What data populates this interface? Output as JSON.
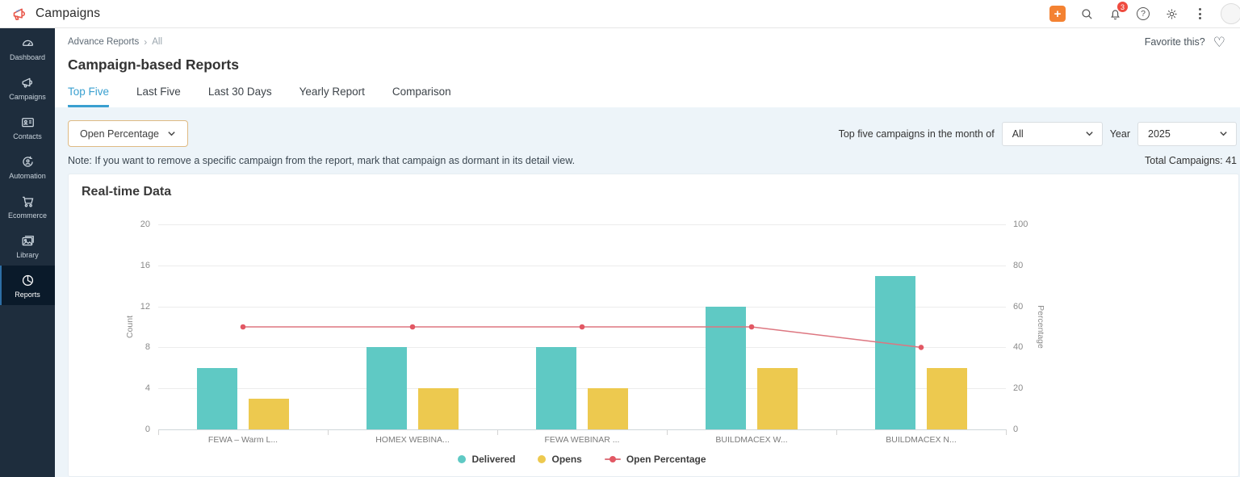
{
  "app": {
    "logo_text": "Campaigns"
  },
  "topbar": {
    "plus_label": "+",
    "notification_count": "3",
    "help_glyph": "?",
    "icons": [
      "plus-button",
      "search-icon",
      "bell-icon",
      "help-icon",
      "gear-icon",
      "kebab-icon",
      "avatar"
    ]
  },
  "sidebar": {
    "items": [
      {
        "label": "Dashboard",
        "icon": "dashboard-icon",
        "active": false
      },
      {
        "label": "Campaigns",
        "icon": "campaigns-icon",
        "active": false
      },
      {
        "label": "Contacts",
        "icon": "contacts-icon",
        "active": false
      },
      {
        "label": "Automation",
        "icon": "automation-icon",
        "active": false
      },
      {
        "label": "Ecommerce",
        "icon": "ecommerce-icon",
        "active": false
      },
      {
        "label": "Library",
        "icon": "library-icon",
        "active": false
      },
      {
        "label": "Reports",
        "icon": "reports-icon",
        "active": true
      }
    ]
  },
  "page": {
    "breadcrumb": {
      "first": "Advance Reports",
      "separator": "›",
      "last": "All"
    },
    "favorite_label": "Favorite this?",
    "favorite_icon": "♡",
    "title": "Campaign-based Reports",
    "tabs": [
      {
        "label": "Top Five",
        "active": true
      },
      {
        "label": "Last Five",
        "active": false
      },
      {
        "label": "Last 30 Days",
        "active": false
      },
      {
        "label": "Yearly Report",
        "active": false
      },
      {
        "label": "Comparison",
        "active": false
      }
    ],
    "filters": {
      "metric_dropdown": "Open Percentage",
      "month_label": "Top five campaigns in the month of",
      "month_value": "All",
      "year_label": "Year",
      "year_value": "2025"
    },
    "note": "Note: If you want to remove a specific campaign from the report, mark that campaign as dormant in its detail view.",
    "total_campaigns": "Total Campaigns: 41"
  },
  "chart_data": {
    "type": "bar",
    "title": "Real-time Data",
    "categories": [
      "FEWA – Warm L...",
      "HOMEX WEBINA...",
      "FEWA WEBINAR ...",
      "BUILDMACEX W...",
      "BUILDMACEX N..."
    ],
    "series": [
      {
        "name": "Delivered",
        "type": "bar",
        "axis": "left",
        "color": "#5fc9c4",
        "values": [
          6,
          8,
          8,
          12,
          15
        ]
      },
      {
        "name": "Opens",
        "type": "bar",
        "axis": "left",
        "color": "#edc94f",
        "values": [
          3,
          4,
          4,
          6,
          6
        ]
      },
      {
        "name": "Open Percentage",
        "type": "line",
        "axis": "right",
        "color": "#dd7680",
        "marker_color": "#e25864",
        "values": [
          50,
          50,
          50,
          50,
          40
        ]
      }
    ],
    "left_axis": {
      "label": "Count",
      "min": 0,
      "max": 20,
      "ticks": [
        0,
        4,
        8,
        12,
        16,
        20
      ]
    },
    "right_axis": {
      "label": "Percentage",
      "min": 0,
      "max": 100,
      "ticks": [
        0,
        20,
        40,
        60,
        80,
        100
      ]
    },
    "grid": true,
    "legend_position": "bottom"
  }
}
